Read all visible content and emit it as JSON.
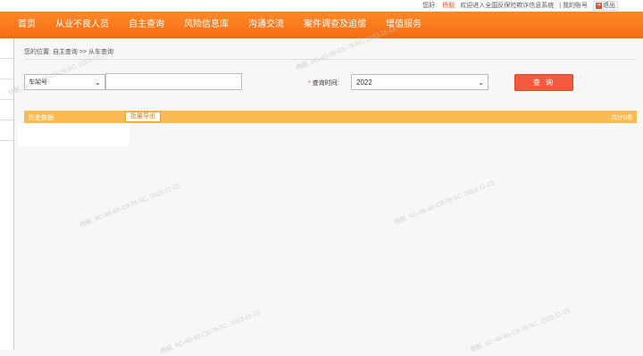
{
  "topbar": {
    "greeting": "您好:",
    "username": "杨毅",
    "welcome": "欢迎进入全国反保险欺诈信息系统",
    "account": "| 我的账号",
    "logout": "退出"
  },
  "nav": {
    "items": [
      "首页",
      "从业不良人员",
      "自主查询",
      "风险信息库",
      "沟通交流",
      "案件调查及追偿",
      "增值服务"
    ]
  },
  "breadcrumb": "您的位置: 自主查询 >> 从车查询",
  "search": {
    "type_selected": "车架号",
    "vin_value": "",
    "time_label": "查询时间:",
    "time_required_mark": "*",
    "year_selected": "2022",
    "query_button": "查 询"
  },
  "history": {
    "label": "历史数据",
    "export_button": "批量导出",
    "total": "共计0条"
  },
  "watermark": "杨毅, 6C-4B-90-C9-76-5C, 2023-11-23"
}
